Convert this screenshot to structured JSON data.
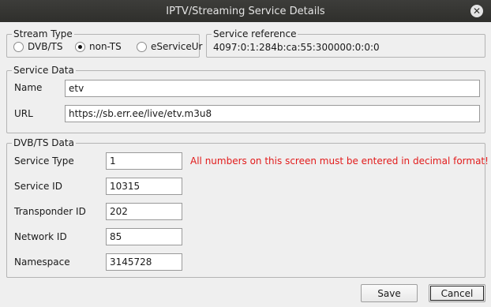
{
  "window": {
    "title": "IPTV/Streaming Service Details",
    "close_glyph": "✕"
  },
  "stream_type": {
    "title": "Stream Type",
    "options": [
      {
        "label": "DVB/TS",
        "checked": false
      },
      {
        "label": "non-TS",
        "checked": true
      },
      {
        "label": "eServiceUr",
        "checked": false
      }
    ]
  },
  "service_reference": {
    "title": "Service reference",
    "value": "4097:0:1:284b:ca:55:300000:0:0:0"
  },
  "service_data": {
    "title": "Service Data",
    "name_label": "Name",
    "name_value": "etv",
    "url_label": "URL",
    "url_value": "https://sb.err.ee/live/etv.m3u8"
  },
  "dvb_data": {
    "title": "DVB/TS Data",
    "warning": "All numbers on this screen must be entered in decimal format!",
    "warning_color": "#e21b1b",
    "fields": [
      {
        "label": "Service Type",
        "value": "1"
      },
      {
        "label": "Service ID",
        "value": "10315"
      },
      {
        "label": "Transponder ID",
        "value": "202"
      },
      {
        "label": "Network ID",
        "value": "85"
      },
      {
        "label": "Namespace",
        "value": "3145728"
      }
    ]
  },
  "buttons": {
    "save": "Save",
    "cancel": "Cancel"
  }
}
